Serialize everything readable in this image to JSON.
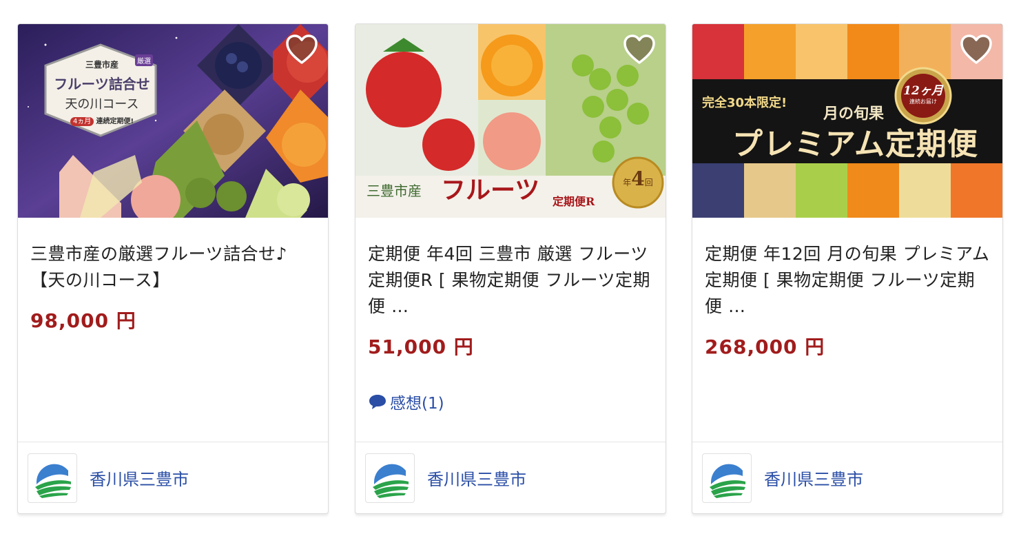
{
  "cards": [
    {
      "image": {
        "badge_top": "三豊市産",
        "badge_sel": "厳選",
        "badge_main": "フルーツ詰合せ",
        "badge_sub": "天の川コース",
        "badge_months": "4ヵ月",
        "badge_note": "連続定期便!"
      },
      "title": "三豊市産の厳選フルーツ詰合せ♪【天の川コース】",
      "price": "98,000 円",
      "municipality": "香川県三豊市"
    },
    {
      "image": {
        "origin": "三豊市産",
        "main": "フルーツ",
        "sub": "定期便R",
        "seal_year": "年",
        "seal_count": "4",
        "seal_unit": "回"
      },
      "title": "定期便 年4回 三豊市 厳選 フルーツ定期便R [ 果物定期便 フルーツ定期便 …",
      "price": "51,000 円",
      "review": "感想(1)",
      "municipality": "香川県三豊市"
    },
    {
      "image": {
        "limited": "完全30本限定!",
        "subtitle": "月の旬果",
        "main": "プレミアム定期便",
        "seal_top": "12ヶ月",
        "seal_bottom": "連続お届け"
      },
      "title": "定期便 年12回 月の旬果 プレミアム 定期便 [ 果物定期便 フルーツ定期便 …",
      "price": "268,000 円",
      "municipality": "香川県三豊市"
    }
  ],
  "icons": {
    "favorite": "heart-icon",
    "review": "speech-bubble-icon",
    "logo": "municipality-logo"
  },
  "colors": {
    "price": "#a11c1c",
    "link": "#2a4ea6"
  }
}
